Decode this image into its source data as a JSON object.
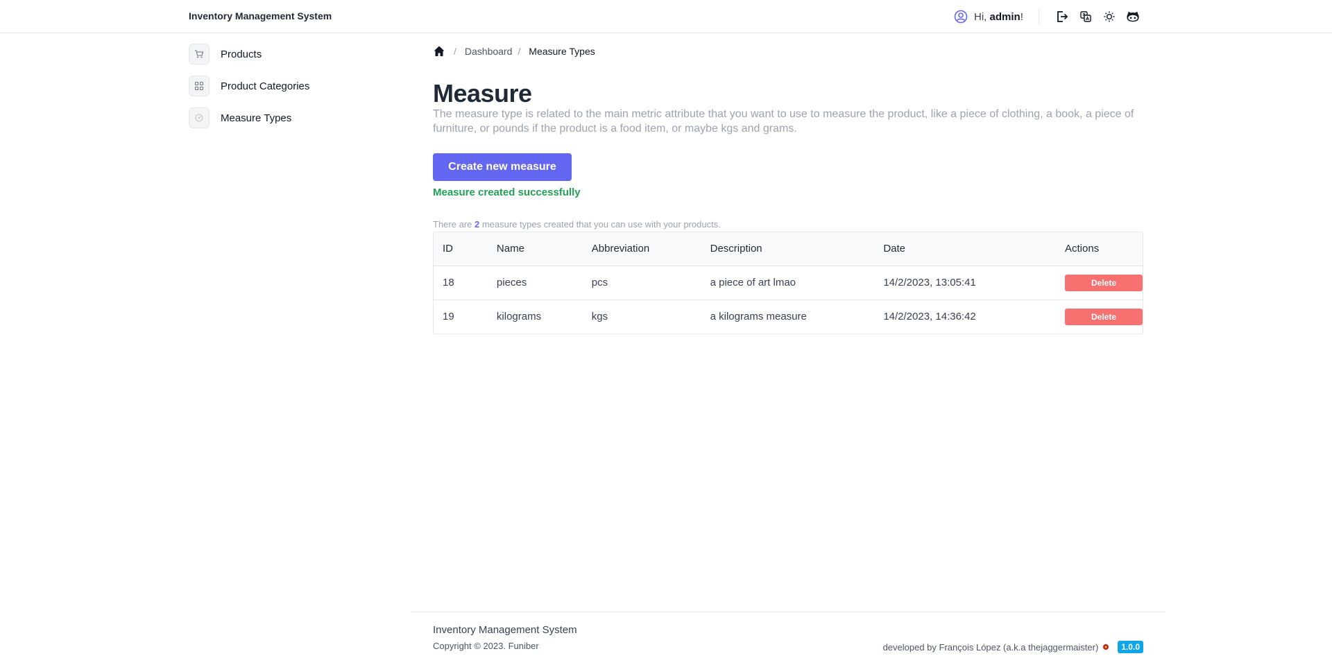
{
  "header": {
    "app_title": "Inventory Management System",
    "greeting": "Hi, ",
    "username": "admin",
    "exclamation": "!",
    "icons": [
      "user-circle-icon",
      "logout-icon",
      "translate-icon",
      "sun-icon",
      "github-icon"
    ]
  },
  "sidebar": {
    "items": [
      {
        "label": "Products",
        "icon": "cart-icon"
      },
      {
        "label": "Product Categories",
        "icon": "grid-icon"
      },
      {
        "label": "Measure Types",
        "icon": "measure-icon"
      }
    ]
  },
  "breadcrumb": {
    "sep": "/",
    "items": [
      "Dashboard",
      "Measure Types"
    ]
  },
  "main": {
    "title": "Measure",
    "description": "The measure type is related to the main metric attribute that you want to use to measure the product, like a piece of clothing, a book, a piece of furniture, or pounds if the product is a food item, or maybe kgs and grams.",
    "create_button": "Create new measure",
    "success_message": "Measure created successfully",
    "count_prefix": "There are ",
    "count": "2",
    "count_suffix": " measure types created that you can use with your products."
  },
  "table": {
    "columns": [
      "ID",
      "Name",
      "Abbreviation",
      "Description",
      "Date",
      "Actions"
    ],
    "rows": [
      {
        "id": "18",
        "name": "pieces",
        "abbreviation": "pcs",
        "description": "a piece of art lmao",
        "date": "14/2/2023, 13:05:41",
        "action": "Delete"
      },
      {
        "id": "19",
        "name": "kilograms",
        "abbreviation": "kgs",
        "description": "a kilograms measure",
        "date": "14/2/2023, 14:36:42",
        "action": "Delete"
      }
    ]
  },
  "footer": {
    "title": "Inventory Management System",
    "copyright": "Copyright © 2023. Funiber",
    "developed_by": "developed by François López (a.k.a thejaggermaister)",
    "version": "1.0.0"
  },
  "colors": {
    "accent": "#6366f1",
    "success": "#22a055",
    "danger": "#f87171",
    "version_badge": "#0ea5e9"
  }
}
